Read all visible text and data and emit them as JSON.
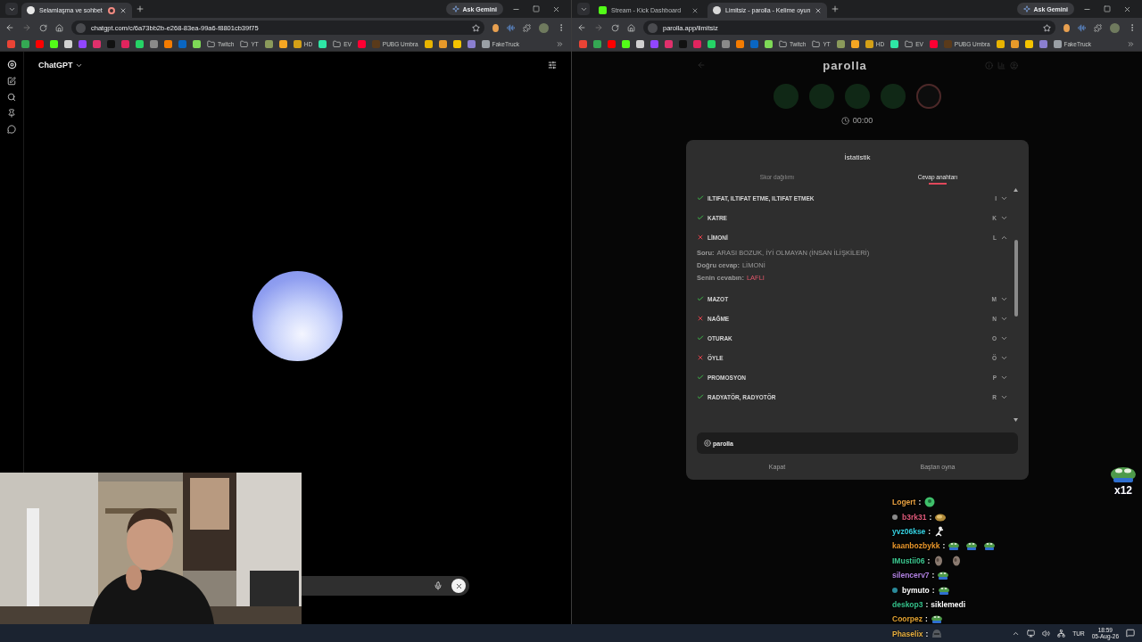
{
  "windows": [
    {
      "tabs": [
        {
          "title": "Selamlaşma ve sohbet",
          "favicon": {
            "kind": "chatgpt"
          },
          "recording": true,
          "selected": true
        }
      ],
      "ask_button": "Ask Gemini",
      "url": "chatgpt.com/c/6a73bb2b-e268-83ea-99a6-f8801cb39f75",
      "bookmarks": [
        {
          "kind": "site",
          "color": "#ea4335"
        },
        {
          "kind": "site",
          "color": "#34a853"
        },
        {
          "kind": "site",
          "color": "#ff0000"
        },
        {
          "kind": "site",
          "color": "#53fc18"
        },
        {
          "kind": "site",
          "color": "#d0d0d0"
        },
        {
          "kind": "site",
          "color": "#9146ff"
        },
        {
          "kind": "site",
          "color": "#e1306c"
        },
        {
          "kind": "site",
          "color": "#111111"
        },
        {
          "kind": "site",
          "color": "#e0245e"
        },
        {
          "kind": "site",
          "color": "#25d366"
        },
        {
          "kind": "site",
          "color": "#8a8a8a"
        },
        {
          "kind": "site",
          "color": "#f57c00"
        },
        {
          "kind": "site",
          "color": "#0a66c2"
        },
        {
          "kind": "site",
          "color": "#7ed957"
        },
        {
          "kind": "folder",
          "label": "Twitch"
        },
        {
          "kind": "folder",
          "label": "YT"
        },
        {
          "kind": "site",
          "color": "#8a9a5b"
        },
        {
          "kind": "site",
          "color": "#f5a623"
        },
        {
          "kind": "site",
          "color": "#d4a017",
          "label": "HD"
        },
        {
          "kind": "site",
          "color": "#2ee6a6"
        },
        {
          "kind": "folder",
          "label": "EV"
        },
        {
          "kind": "site",
          "color": "#ff0033"
        },
        {
          "kind": "site",
          "color": "#5a3a1a",
          "label": "PUBG Umbra"
        },
        {
          "kind": "site",
          "color": "#e8b400"
        },
        {
          "kind": "site",
          "color": "#e89a2a"
        },
        {
          "kind": "site",
          "color": "#f5c400"
        },
        {
          "kind": "site",
          "color": "#8a7fd0"
        },
        {
          "kind": "site",
          "color": "#9aa0a6",
          "label": "FakeTruck"
        }
      ],
      "page": {
        "kind": "chat",
        "model_label": "ChatGPT"
      }
    },
    {
      "tabs": [
        {
          "title": "Stream - Kick Dashboard",
          "favicon": {
            "kind": "kick"
          },
          "recording": false,
          "selected": false
        },
        {
          "title": "Limitsiz - parolla - Kelime oyun",
          "favicon": {
            "kind": "parolla"
          },
          "recording": false,
          "selected": true
        }
      ],
      "ask_button": "Ask Gemini",
      "url": "parolla.app/limitsiz",
      "bookmarks": [
        {
          "kind": "site",
          "color": "#ea4335"
        },
        {
          "kind": "site",
          "color": "#34a853"
        },
        {
          "kind": "site",
          "color": "#ff0000"
        },
        {
          "kind": "site",
          "color": "#53fc18"
        },
        {
          "kind": "site",
          "color": "#d0d0d0"
        },
        {
          "kind": "site",
          "color": "#9146ff"
        },
        {
          "kind": "site",
          "color": "#e1306c"
        },
        {
          "kind": "site",
          "color": "#111111"
        },
        {
          "kind": "site",
          "color": "#e0245e"
        },
        {
          "kind": "site",
          "color": "#25d366"
        },
        {
          "kind": "site",
          "color": "#8a8a8a"
        },
        {
          "kind": "site",
          "color": "#f57c00"
        },
        {
          "kind": "site",
          "color": "#0a66c2"
        },
        {
          "kind": "site",
          "color": "#7ed957"
        },
        {
          "kind": "folder",
          "label": "Twitch"
        },
        {
          "kind": "folder",
          "label": "YT"
        },
        {
          "kind": "site",
          "color": "#8a9a5b"
        },
        {
          "kind": "site",
          "color": "#f5a623"
        },
        {
          "kind": "site",
          "color": "#d4a017",
          "label": "HD"
        },
        {
          "kind": "site",
          "color": "#2ee6a6"
        },
        {
          "kind": "folder",
          "label": "EV"
        },
        {
          "kind": "site",
          "color": "#ff0033"
        },
        {
          "kind": "site",
          "color": "#5a3a1a",
          "label": "PUBG Umbra"
        },
        {
          "kind": "site",
          "color": "#e8b400"
        },
        {
          "kind": "site",
          "color": "#e89a2a"
        },
        {
          "kind": "site",
          "color": "#f5c400"
        },
        {
          "kind": "site",
          "color": "#8a7fd0"
        },
        {
          "kind": "site",
          "color": "#9aa0a6",
          "label": "FakeTruck"
        }
      ],
      "page": {
        "kind": "game",
        "title": "parolla",
        "timer": "00:00",
        "modal": {
          "title": "İstatistik",
          "tabs": [
            {
              "label": "Skor dağılımı",
              "selected": false
            },
            {
              "label": "Cevap anahtarı",
              "selected": true
            }
          ],
          "answers": [
            {
              "text": "ILTIFAT, ILTIFAT ETME, ILTIFAT ETMEK",
              "correct": true,
              "letter": "I",
              "expanded": false
            },
            {
              "text": "KATRE",
              "correct": true,
              "letter": "K",
              "expanded": false
            },
            {
              "text": "LİMONİ",
              "correct": false,
              "letter": "L",
              "expanded": true,
              "details": [
                {
                  "label": "Soru:",
                  "value": "ARASI BOZUK, İYİ OLMAYAN (İNSAN İLİŞKİLERİ)",
                  "highlight": false
                },
                {
                  "label": "Doğru cevap:",
                  "value": "LİMONİ",
                  "highlight": false
                },
                {
                  "label": "Senin cevabın:",
                  "value": "LAFLI",
                  "highlight": true
                }
              ]
            },
            {
              "text": "MAZOT",
              "correct": true,
              "letter": "M",
              "expanded": false
            },
            {
              "text": "NAĞME",
              "correct": false,
              "letter": "N",
              "expanded": false
            },
            {
              "text": "OTURAK",
              "correct": true,
              "letter": "O",
              "expanded": false
            },
            {
              "text": "ÖYLE",
              "correct": false,
              "letter": "Ö",
              "expanded": false
            },
            {
              "text": "PROMOSYON",
              "correct": true,
              "letter": "P",
              "expanded": false
            },
            {
              "text": "RADYATÖR, RADYOTÖR",
              "correct": true,
              "letter": "R",
              "expanded": false
            }
          ],
          "brand": "parolla",
          "buttons": [
            "Kapat",
            "Baştan oyna"
          ]
        }
      }
    }
  ],
  "chat_overlay": {
    "combo": "x12",
    "messages": [
      {
        "user": "Logert",
        "color": "#e8a040",
        "separator": ":",
        "emotes": [
          {
            "kind": "ball"
          }
        ]
      },
      {
        "user": "b3rk31",
        "color": "#e05a7a",
        "badge": {
          "color": "#8a8a8a"
        },
        "separator": ":",
        "emotes": [
          {
            "kind": "shell"
          }
        ]
      },
      {
        "user": "yvz06kse",
        "color": "#35d0e0",
        "separator": ":",
        "emotes": [
          {
            "kind": "figure"
          }
        ]
      },
      {
        "user": "kaanbozbykk",
        "color": "#e8952a",
        "separator": ":",
        "emotes": [
          {
            "kind": "frog"
          },
          {
            "kind": "frog"
          },
          {
            "kind": "frog"
          }
        ]
      },
      {
        "user": "IMustii06",
        "color": "#3cc890",
        "separator": ":",
        "emotes": [
          {
            "kind": "stone"
          },
          {
            "kind": "stone"
          }
        ]
      },
      {
        "user": "silencerv7",
        "color": "#b080e0",
        "separator": ":",
        "emotes": [
          {
            "kind": "frog"
          }
        ]
      },
      {
        "user": "bymuto",
        "color": "#ffffff",
        "badge": {
          "color": "#2a8a9a"
        },
        "separator": ":",
        "emotes": [
          {
            "kind": "frog"
          }
        ]
      },
      {
        "user": "deskop3",
        "color": "#35c08a",
        "separator": ":",
        "text": "siklemedi"
      },
      {
        "user": "Coorpez",
        "color": "#e0a030",
        "separator": ":",
        "emotes": [
          {
            "kind": "frog"
          }
        ]
      },
      {
        "user": "Phaselix",
        "color": "#e8b040",
        "separator": ":",
        "emotes": [
          {
            "kind": "helmet"
          }
        ]
      }
    ]
  },
  "taskbar": {
    "language": "TUR",
    "time": "18:59",
    "date": "05-Aug-26"
  }
}
